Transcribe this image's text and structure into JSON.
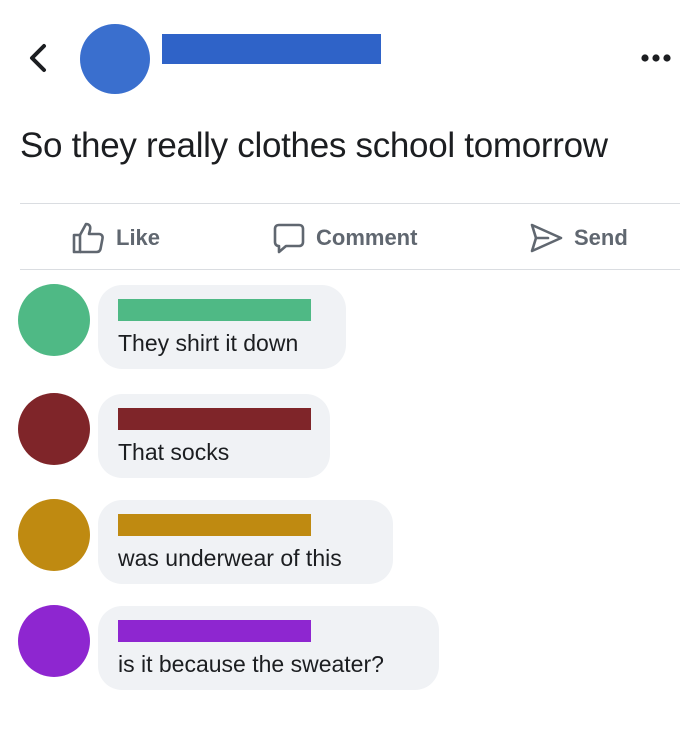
{
  "header": {
    "back_icon": "chevron-left-icon",
    "more_icon": "ellipsis-horizontal-icon",
    "avatar_color": "#3a6fce",
    "name_redaction_color": "#2f63c8"
  },
  "post": {
    "text": "So they really clothes school tomorrow"
  },
  "actions": {
    "like_label": "Like",
    "comment_label": "Comment",
    "send_label": "Send"
  },
  "comments": [
    {
      "text": "They shirt it down",
      "color": "#4fb985"
    },
    {
      "text": "That socks",
      "color": "#7f2529"
    },
    {
      "text": "was underwear of this",
      "color": "#bf8a11"
    },
    {
      "text": "is it because the sweater?",
      "color": "#8e26d0"
    }
  ]
}
